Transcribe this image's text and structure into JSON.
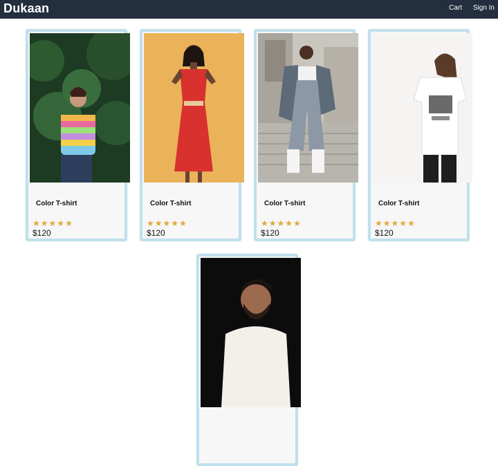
{
  "header": {
    "brand": "Dukaan",
    "nav": {
      "cart": "Cart",
      "signin": "Sign In"
    }
  },
  "products": [
    {
      "name": "Color T-shirt",
      "rating": 5,
      "price": "$120",
      "image_icon": "model-photo-icon"
    },
    {
      "name": "Color T-shirt",
      "rating": 5,
      "price": "$120",
      "image_icon": "model-photo-icon"
    },
    {
      "name": "Color T-shirt",
      "rating": 5,
      "price": "$120",
      "image_icon": "model-photo-icon"
    },
    {
      "name": "Color T-shirt",
      "rating": 5,
      "price": "$120",
      "image_icon": "model-photo-icon"
    }
  ],
  "colors": {
    "navbar": "#232f3e",
    "card_border": "#bfe0ee",
    "star": "#e0a93a"
  },
  "star_glyph": "★"
}
